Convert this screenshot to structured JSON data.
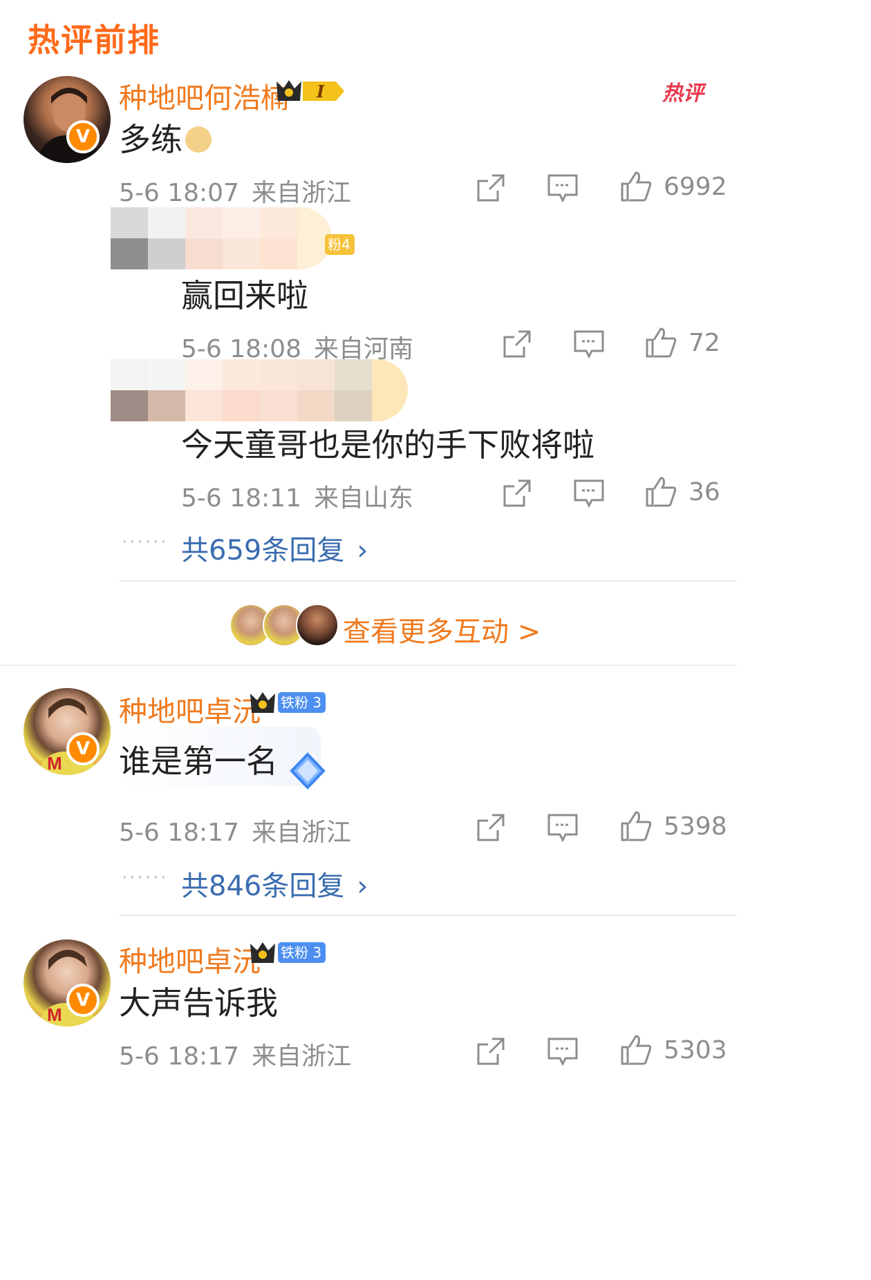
{
  "section_title": "热评前排",
  "comments": [
    {
      "username": "种地吧何浩楠",
      "level": "I",
      "text": "多练",
      "time": "5-6 18:07",
      "location": "来自浙江",
      "likes": "6992",
      "hot_badge": "热评",
      "replies": [
        {
          "text": "赢回来啦",
          "time": "5-6 18:08",
          "location": "来自河南",
          "likes": "72",
          "badge_fragment": "粉4"
        },
        {
          "text": "今天童哥也是你的手下败将啦",
          "time": "5-6 18:11",
          "location": "来自山东",
          "likes": "36"
        }
      ],
      "reply_total": "共659条回复",
      "more_interactions": "查看更多互动 >"
    },
    {
      "username": "种地吧卓沅",
      "fan_badge": "铁粉 3",
      "text": "谁是第一名",
      "time": "5-6 18:17",
      "location": "来自浙江",
      "likes": "5398",
      "reply_total": "共846条回复"
    },
    {
      "username": "种地吧卓沅",
      "fan_badge": "铁粉 3",
      "text": "大声告诉我",
      "time": "5-6 18:17",
      "location": "来自浙江",
      "likes": "5303"
    }
  ],
  "icons": {
    "share": "share-icon",
    "comment": "comment-icon",
    "like": "thumbs-up-icon",
    "verified": "verified-v-icon",
    "crown": "crown-icon"
  },
  "colors": {
    "accent_orange": "#f07a1e",
    "link_blue": "#3a6cb0",
    "meta_gray": "#8d8d8d",
    "hot_red": "#e8394c"
  }
}
